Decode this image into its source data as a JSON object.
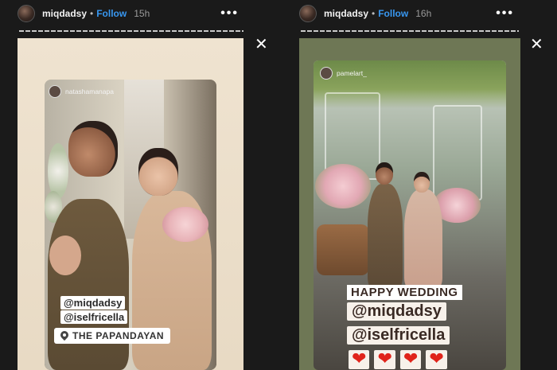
{
  "stories": [
    {
      "username": "miqdadsy",
      "follow_label": "Follow",
      "time": "15h",
      "repost_user": "natashamanapa",
      "mentions": [
        "@miqdadsy",
        "@iselfricella"
      ],
      "location": "THE PAPANDAYAN"
    },
    {
      "username": "miqdadsy",
      "follow_label": "Follow",
      "time": "16h",
      "repost_user": "pamelart_",
      "greeting": "HAPPY WEDDING",
      "mentions": [
        "@miqdadsy",
        "@iselfricella"
      ],
      "hearts": [
        "❤",
        "❤",
        "❤",
        "❤"
      ]
    }
  ],
  "icons": {
    "more": "more-options-icon",
    "close": "close-icon",
    "location": "location-pin-icon"
  },
  "colors": {
    "follow": "#3897f0",
    "background": "#1a1a1a",
    "heart": "#e0241b"
  }
}
